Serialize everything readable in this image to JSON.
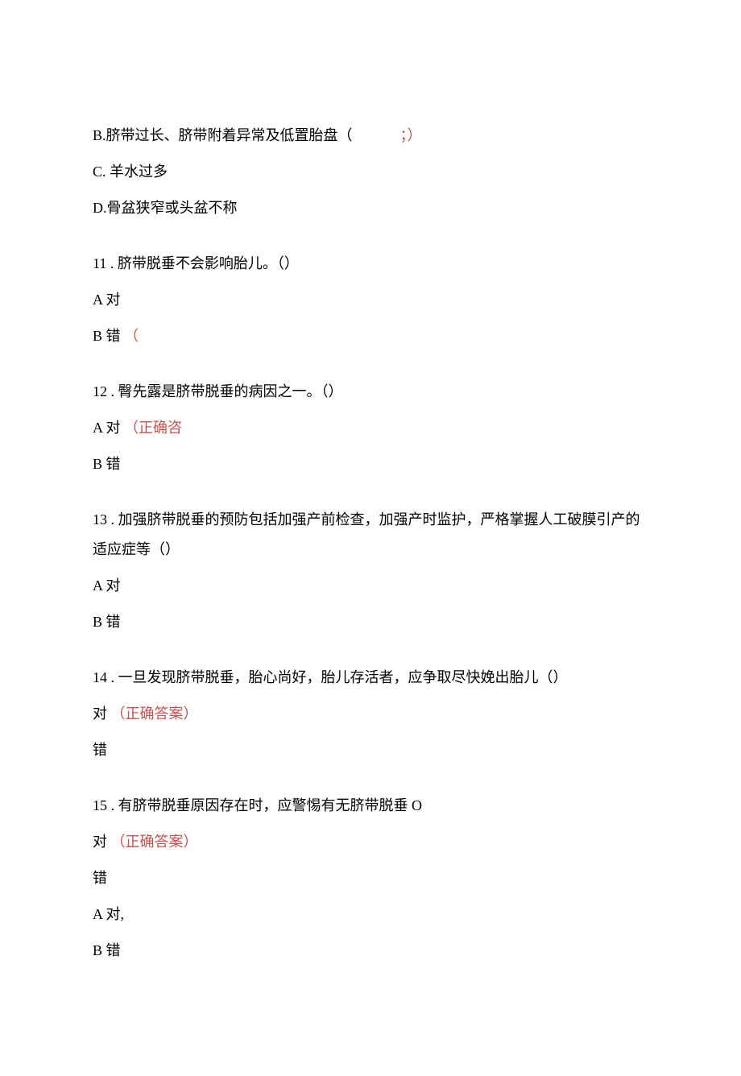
{
  "q10": {
    "optB_text": "B.脐带过长、脐带附着异常及低置胎盘（",
    "optB_mark": "；）",
    "optC": "C. 羊水过多",
    "optD": "D.骨盆狭窄或头盆不称"
  },
  "q11": {
    "stem": "11 . 脐带脱垂不会影响胎儿。（）",
    "optA": "A 对",
    "optB_text": "B 错",
    "optB_mark": "（"
  },
  "q12": {
    "stem": "12 . 臀先露是脐带脱垂的病因之一。（）",
    "optA_text": "A 对",
    "optA_mark": "（正确咨",
    "optB": "B 错"
  },
  "q13": {
    "stem_line1": "13 . 加强脐带脱垂的预防包括加强产前检查，加强产时监护，严格掌握人工破膜引产的",
    "stem_line2": "适应症等（）",
    "optA": "A 对",
    "optB": "B 错"
  },
  "q14": {
    "stem": "14 . 一旦发现脐带脱垂，胎心尚好，胎儿存活者，应争取尽快娩出胎儿（）",
    "optA_text": "对",
    "optA_mark": "（正确答案）",
    "optB": "错"
  },
  "q15": {
    "stem": "15 . 有脐带脱垂原因存在时，应警惕有无脐带脱垂 O",
    "optA_text": "对",
    "optA_mark": "（正确答案）",
    "optB": "错",
    "extraA": "A 对,",
    "extraB": "B 错"
  }
}
